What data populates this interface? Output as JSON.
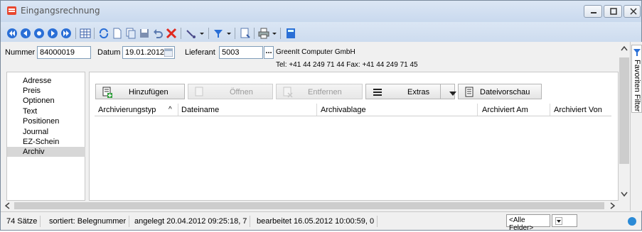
{
  "window": {
    "title": "Eingangsrechnung",
    "accent": "#c9d9ee"
  },
  "toolbar": {
    "icons": [
      "first-record-icon",
      "prev-page-icon",
      "prev-record-icon",
      "next-record-icon",
      "last-record-icon",
      "table-icon",
      "refresh-icon",
      "new-document-icon",
      "copy-icon",
      "save-icon",
      "undo-icon",
      "delete-icon",
      "tools-icon",
      "filter-icon",
      "report-icon",
      "print-icon",
      "calculator-icon"
    ]
  },
  "header": {
    "nummer_label": "Nummer",
    "nummer_value": "84000019",
    "datum_label": "Datum",
    "datum_value": "19.01.2012",
    "lieferant_label": "Lieferant",
    "lieferant_value": "5003",
    "lieferant_lookup": "...",
    "lieferant_name": "GreenIt Computer GmbH",
    "contact": "Tel: +41 44 249 71 44   Fax: +41 44 249 71 45"
  },
  "sidebar": {
    "items": [
      {
        "label": "Adresse"
      },
      {
        "label": "Preis"
      },
      {
        "label": "Optionen"
      },
      {
        "label": "Text"
      },
      {
        "label": "Positionen"
      },
      {
        "label": "Journal"
      },
      {
        "label": "EZ-Schein"
      },
      {
        "label": "Archiv"
      }
    ],
    "selected": "Archiv"
  },
  "actions": {
    "add": "Hinzufügen",
    "open": "Öffnen",
    "remove": "Entfernen",
    "extras": "Extras",
    "preview": "Dateivorschau"
  },
  "grid": {
    "columns": [
      "Archivierungstyp",
      "Dateiname",
      "Archivablage",
      "Archiviert Am",
      "Archiviert Von"
    ],
    "sort_indicator": "^"
  },
  "favorites": {
    "label": "Favoriten Filter"
  },
  "status": {
    "count": "74 Sätze",
    "sort": "sortiert: Belegnummer",
    "created": "angelegt 20.04.2012 09:25:18,  7",
    "edited": "bearbeitet 16.05.2012 10:00:59,  0",
    "filter_value": "<Alle Felder>"
  }
}
